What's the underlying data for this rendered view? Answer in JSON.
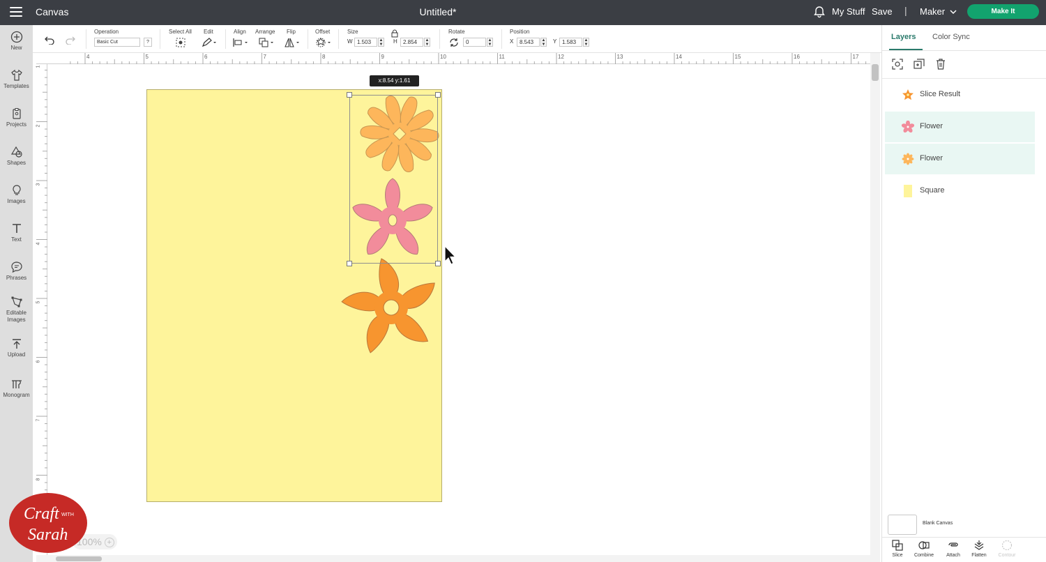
{
  "header": {
    "app_title": "Canvas",
    "document_title": "Untitled*",
    "my_stuff": "My Stuff",
    "save": "Save",
    "separator": "|",
    "machine": "Maker",
    "make_it": "Make It"
  },
  "rail": [
    {
      "label": "New",
      "icon": "plus-circle-icon"
    },
    {
      "label": "Templates",
      "icon": "shirt-icon"
    },
    {
      "label": "Projects",
      "icon": "clipboard-icon"
    },
    {
      "label": "Shapes",
      "icon": "shapes-icon"
    },
    {
      "label": "Images",
      "icon": "lightbulb-icon"
    },
    {
      "label": "Text",
      "icon": "text-icon"
    },
    {
      "label": "Phrases",
      "icon": "speech-bubble-icon"
    },
    {
      "label": "Editable Images",
      "icon": "editable-image-icon"
    },
    {
      "label": "Upload",
      "icon": "upload-icon"
    },
    {
      "label": "Monogram",
      "icon": "monogram-icon"
    }
  ],
  "toolbar": {
    "operation_label": "Operation",
    "operation_value": "Basic Cut",
    "help_label": "?",
    "select_all_label": "Select All",
    "edit_label": "Edit",
    "align_label": "Align",
    "arrange_label": "Arrange",
    "flip_label": "Flip",
    "offset_label": "Offset",
    "size_label": "Size",
    "w_label": "W",
    "w_value": "1.503",
    "h_label": "H",
    "h_value": "2.854",
    "rotate_label": "Rotate",
    "rotate_value": "0",
    "position_label": "Position",
    "x_label": "X",
    "x_value": "8.543",
    "y_label": "Y",
    "y_value": "1.583"
  },
  "ruler": {
    "top": [
      "4",
      "5",
      "6",
      "7",
      "8",
      "9",
      "10",
      "11",
      "12",
      "13",
      "14",
      "15",
      "16",
      "17"
    ],
    "left": [
      "1",
      "2",
      "3",
      "4",
      "5",
      "6",
      "7",
      "8"
    ]
  },
  "canvas": {
    "tooltip": "x:8.54 y:1.61",
    "zoom": "100%",
    "watermark_line1": "Craft",
    "watermark_with": "WITH",
    "watermark_line2": "Sarah",
    "colors": {
      "square": "#fef49b",
      "flower_light_orange": "#fdb65b",
      "flower_pink": "#f28c9b",
      "flower_dark_orange": "#f7952f"
    }
  },
  "layers_panel": {
    "tabs": [
      "Layers",
      "Color Sync"
    ],
    "layers": [
      {
        "name": "Slice Result",
        "icon": "star-flower-orange-icon",
        "selected": false
      },
      {
        "name": "Flower",
        "icon": "flower-pink-icon",
        "selected": true
      },
      {
        "name": "Flower",
        "icon": "flower-orange-icon",
        "selected": true
      },
      {
        "name": "Square",
        "icon": "square-yellow-icon",
        "selected": false
      }
    ],
    "blank_canvas": "Blank Canvas",
    "actions": [
      {
        "label": "Slice",
        "icon": "slice-icon",
        "enabled": true
      },
      {
        "label": "Combine",
        "icon": "combine-icon",
        "enabled": true
      },
      {
        "label": "Attach",
        "icon": "attach-icon",
        "enabled": true
      },
      {
        "label": "Flatten",
        "icon": "flatten-icon",
        "enabled": true
      },
      {
        "label": "Contour",
        "icon": "contour-icon",
        "enabled": false
      }
    ]
  }
}
